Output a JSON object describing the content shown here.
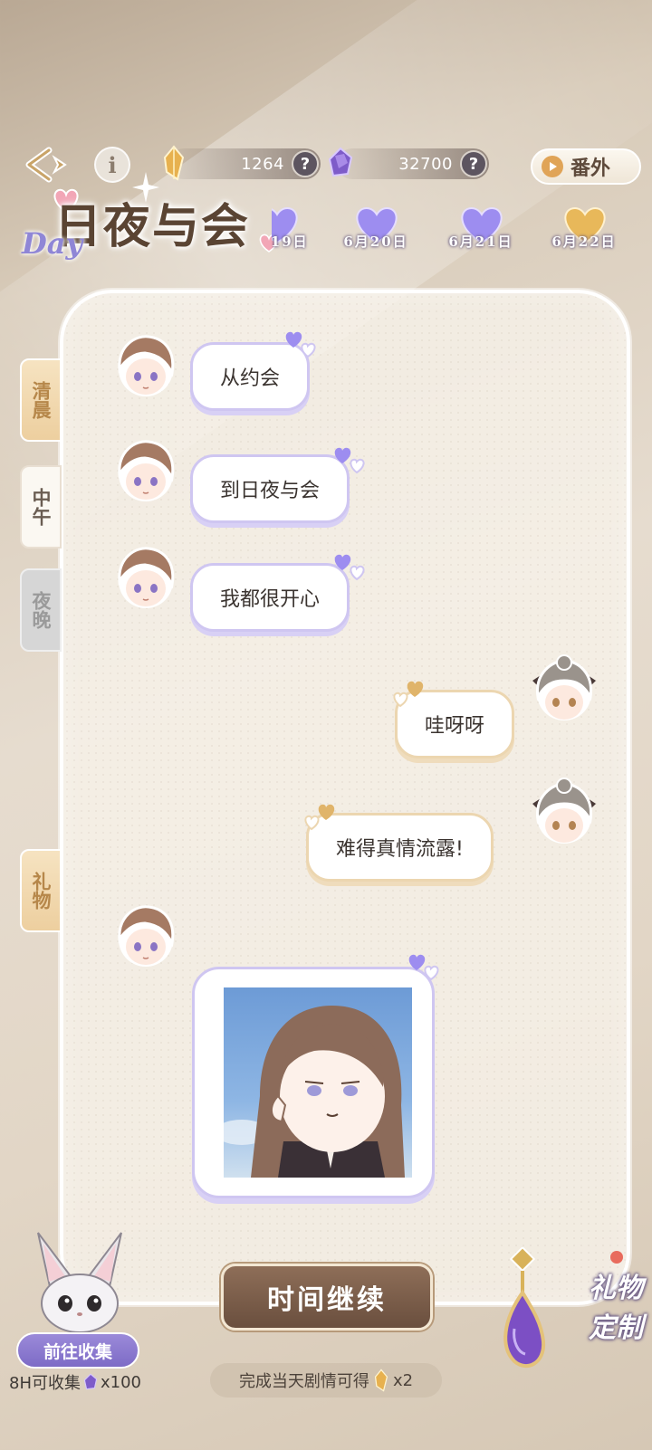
{
  "header": {
    "gold_amount": "1264",
    "purple_amount": "32700",
    "help_label": "?",
    "info_label": "i",
    "extra_label": "番外"
  },
  "logo": {
    "title": "日夜与会",
    "subtitle": "Day"
  },
  "dates": [
    {
      "label": "6月19日",
      "heart_color": "#9d8df0"
    },
    {
      "label": "6月20日",
      "heart_color": "#9d8df0"
    },
    {
      "label": "6月21日",
      "heart_color": "#9d8df0"
    },
    {
      "label": "6月22日",
      "heart_color": "#e8b85a"
    }
  ],
  "tabs": {
    "morning": "清晨",
    "noon": "中午",
    "night": "夜晚",
    "gift": "礼物"
  },
  "messages": [
    {
      "speaker": "male",
      "text": "从约会"
    },
    {
      "speaker": "male",
      "text": "到日夜与会"
    },
    {
      "speaker": "male",
      "text": "我都很开心"
    },
    {
      "speaker": "female",
      "text": "哇呀呀"
    },
    {
      "speaker": "female",
      "text": "难得真情流露!"
    },
    {
      "speaker": "male",
      "type": "image"
    }
  ],
  "footer": {
    "continue_label": "时间继续",
    "reward_text": "完成当天剧情可得",
    "reward_count": "x2",
    "collect_label": "前往收集",
    "collect_note_prefix": "8H可收集",
    "collect_note_suffix": "x100",
    "gift_custom_line1": "礼物",
    "gift_custom_line2": "定制"
  },
  "colors": {
    "purple_accent": "#9d8df0",
    "gold_accent": "#e8b85a",
    "button_brown": "#7a5c48"
  }
}
